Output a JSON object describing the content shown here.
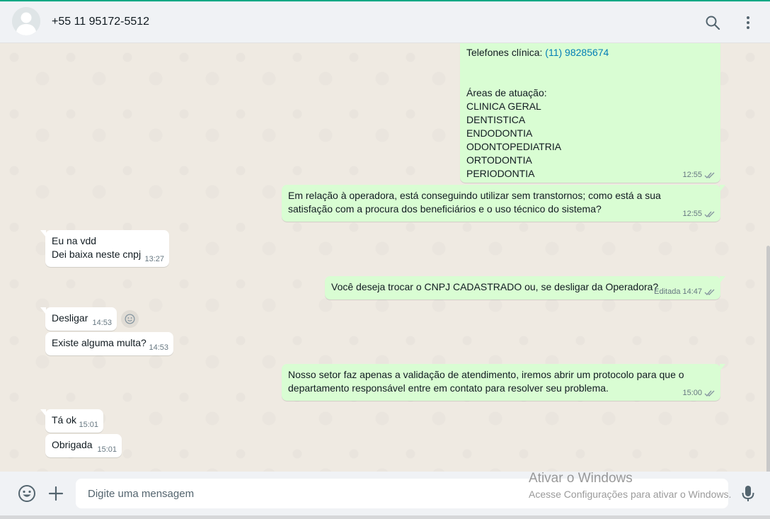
{
  "header": {
    "contact_name": "+55 11 95172-5512"
  },
  "messages": [
    {
      "direction": "out",
      "lines_before_link": "Telefones clínica: ",
      "link": "(11) 98285674",
      "areas_title": "Áreas de atuação:",
      "areas": [
        "CLINICA GERAL",
        "DENTISTICA",
        "ENDODONTIA",
        "ODONTOPEDIATRIA",
        "ORTODONTIA",
        "PERIODONTIA"
      ],
      "time": "12:55"
    },
    {
      "direction": "out",
      "text": "Em relação à operadora, está conseguindo utilizar sem transtornos; como está a sua satisfação com a procura dos beneficiários e o uso técnico do sistema?",
      "time": "12:55"
    },
    {
      "direction": "in",
      "line1": "Eu na vdd",
      "line2": "Dei baixa neste cnpj",
      "time": "13:27"
    },
    {
      "direction": "out",
      "text": "Você deseja trocar o CNPJ CADASTRADO ou, se desligar da Operadora?",
      "edited": "Editada",
      "time": "14:47"
    },
    {
      "direction": "in",
      "text": "Desligar",
      "time": "14:53"
    },
    {
      "direction": "in",
      "text": "Existe alguma multa?",
      "time": "14:53"
    },
    {
      "direction": "out",
      "text": "Nosso setor faz apenas a validação de atendimento, iremos abrir um protocolo para que o departamento responsável entre em contato para resolver seu problema.",
      "time": "15:00"
    },
    {
      "direction": "in",
      "text": "Tá ok",
      "time": "15:01"
    },
    {
      "direction": "in",
      "text": "Obrigada",
      "time": "15:01"
    }
  ],
  "footer": {
    "placeholder": "Digite uma mensagem"
  },
  "watermark": {
    "title": "Ativar o Windows",
    "subtitle": "Acesse Configurações para ativar o Windows."
  },
  "icons": {
    "header": [
      "search-icon",
      "menu-icon"
    ],
    "footer": [
      "emoji-icon",
      "plus-icon",
      "mic-icon"
    ],
    "reaction": "emoji-reaction-icon",
    "read_status": "double-check-icon"
  },
  "colors": {
    "accent": "#00a884",
    "outgoing_bubble": "#d9fdd3",
    "incoming_bubble": "#ffffff",
    "link": "#027eb5",
    "read_ticks": "#8696a0"
  }
}
